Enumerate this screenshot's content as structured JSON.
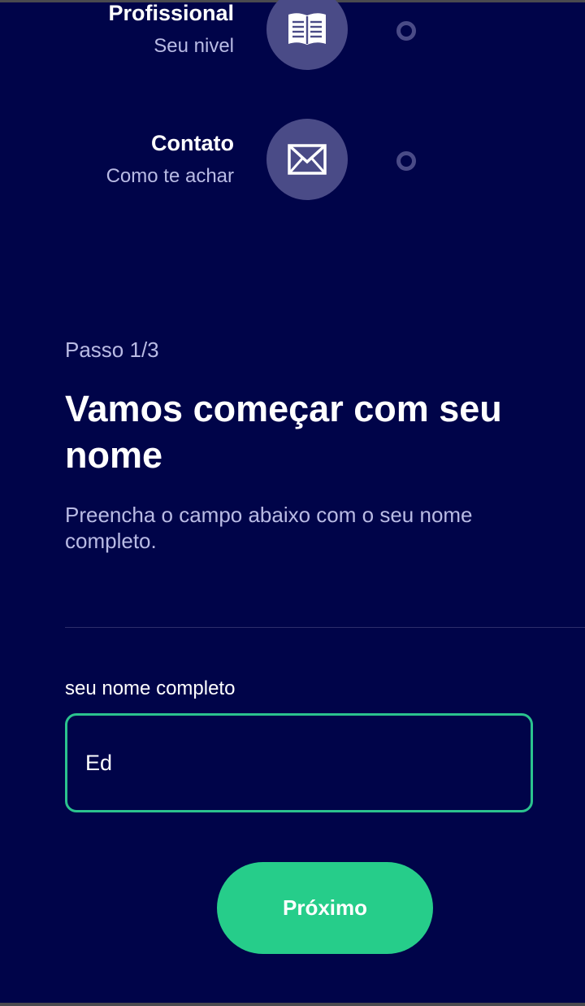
{
  "steps": [
    {
      "title": "Profissional",
      "subtitle": "Seu nivel",
      "icon": "book-icon"
    },
    {
      "title": "Contato",
      "subtitle": "Como te achar",
      "icon": "envelope-icon"
    }
  ],
  "form": {
    "step_indicator": "Passo 1/3",
    "heading": "Vamos começar com seu nome",
    "description": "Preencha o campo abaixo com o seu nome completo.",
    "field_label": "seu nome completo",
    "field_value": "Ed",
    "next_label": "Próximo"
  },
  "colors": {
    "background": "#000449",
    "circle": "#4a4b87",
    "accent": "#26cd8a",
    "muted_text": "#b9bbe4"
  }
}
